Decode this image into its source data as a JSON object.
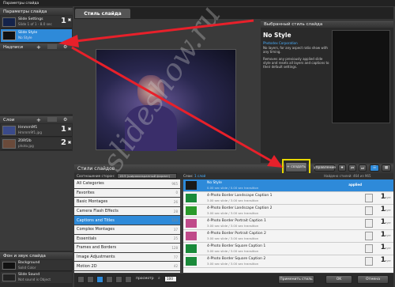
{
  "window": {
    "title": "Параметры слайда"
  },
  "left": {
    "header": "Параметры слайда",
    "slide_item": {
      "title": "Slide Settings",
      "sub": "Slide 1 of 1 - 8.0 sec",
      "num": "1"
    },
    "style_item": {
      "title": "Slide Style",
      "sub": "No Style"
    },
    "captions_header": "Надписи",
    "layers_header": "Слои",
    "layers": [
      {
        "title": "Hmmm9f1",
        "sub": "Hmmm9f1.jpg",
        "num": "1"
      },
      {
        "title": "Z0Rf2b",
        "sub": "photo.jpg",
        "num": "2"
      }
    ],
    "bg_header": "Фон и звук слайда",
    "bg_items": [
      {
        "title": "Background",
        "sub": "Solid Color"
      },
      {
        "title": "Slide Sound",
        "sub": "Not sound is Object"
      }
    ]
  },
  "tab": {
    "label": "Стиль слайда"
  },
  "selected": {
    "header": "Выбранный стиль слайда",
    "name": "No Style",
    "vendor": "Photodex Corporation",
    "desc": "No layers, for any aspect ratio show with any timing.",
    "desc2": "Removes any previously applied slide style and resets all layers and captions to their default settings."
  },
  "styles": {
    "header": "Стили слайдов",
    "create_label": "+ создать",
    "manage_label": "управление",
    "filter_label": "Соотношение сторон:",
    "filter_value": "16:9 (широкоэкранный формат)",
    "list_label": "Слои:",
    "list_count": "1 слой",
    "right_info": "Найдено стилей: 464 из 965",
    "categories": [
      {
        "label": "All Categories",
        "count": "965"
      },
      {
        "label": "Favorites",
        "count": "0"
      },
      {
        "label": "Basic Montages",
        "count": "26"
      },
      {
        "label": "Camera Flash Effects",
        "count": "28"
      },
      {
        "label": "Captions and Titles",
        "count": "124"
      },
      {
        "label": "Complex Montages",
        "count": "37"
      },
      {
        "label": "Essentials",
        "count": "25"
      },
      {
        "label": "Frames and Borders",
        "count": "128"
      },
      {
        "label": "Image Adjustments",
        "count": "77"
      },
      {
        "label": "Motion 2D",
        "count": "42"
      }
    ],
    "items": [
      {
        "title": "No Style",
        "sub": "0.00 sec slide / 0.00 sec transition",
        "applied": "applied",
        "num": "",
        "sec": ""
      },
      {
        "title": "4-Photo Border Landscape Caption 1",
        "sub": "3.00 sec slide / 3.00 sec transition",
        "num": "1",
        "sec": "Layer"
      },
      {
        "title": "4-Photo Border Landscape Caption 2",
        "sub": "3.00 sec slide / 3.00 sec transition",
        "num": "1",
        "sec": "Layer"
      },
      {
        "title": "4-Photo Border Portrait Caption 1",
        "sub": "3.00 sec slide / 3.00 sec transition",
        "num": "1",
        "sec": "Layer"
      },
      {
        "title": "4-Photo Border Portrait Caption 2",
        "sub": "3.00 sec slide / 3.00 sec transition",
        "num": "1",
        "sec": "Layer"
      },
      {
        "title": "4-Photo Border Square Caption 1",
        "sub": "3.00 sec slide / 3.00 sec transition",
        "num": "1",
        "sec": "Layer"
      },
      {
        "title": "4-Photo Border Square Caption 2",
        "sub": "3.00 sec slide / 3.00 sec transition",
        "num": "1",
        "sec": "Layer"
      }
    ]
  },
  "bottom": {
    "apply_label": "Применить стиль",
    "ok_label": "OK",
    "cancel_label": "Отмена",
    "zoom": "100",
    "preview_label": "просмотр"
  },
  "watermark": "slideshow.ru",
  "colors": {
    "accent": "#2e8ad9",
    "highlight": "#e8d800",
    "arrow": "#e8202a"
  }
}
